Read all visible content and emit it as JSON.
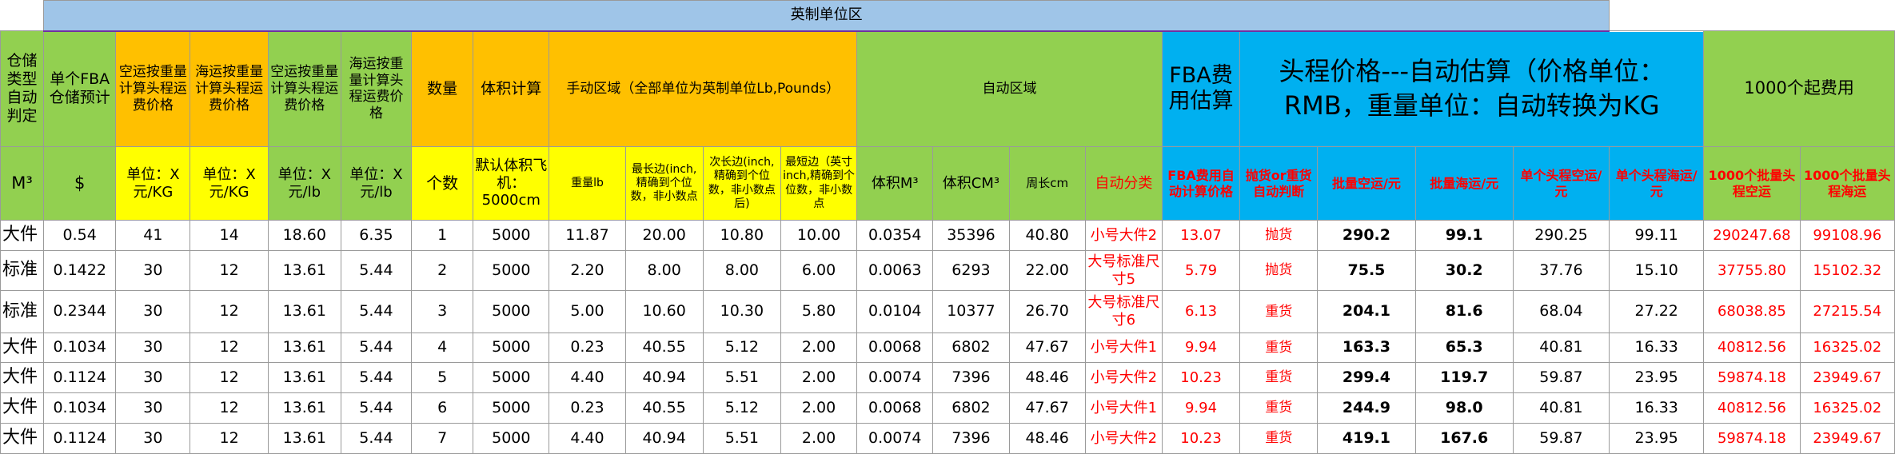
{
  "banner": "英制单位区",
  "header1": [
    "仓储类型自动判定",
    "单个FBA仓储预计",
    "空运按重量计算头程运费价格",
    "海运按重量计算头程运费价格",
    "空运按重量计算头程运费价格",
    "海运按重量计算头程运费价格",
    "数量",
    "体积计算",
    "手动区域（全部单位为英制单位Lb,Pounds）",
    "自动区域",
    "FBA费用估算",
    "头程价格---自动估算（价格单位：RMB，重量单位：自动转换为KG",
    "1000个起费用"
  ],
  "header2": [
    "M³",
    "$",
    "单位：X元/KG",
    "单位：X元/KG",
    "单位：X元/lb",
    "单位：X元/lb",
    "个数",
    "默认体积飞机：5000cm",
    "重量lb",
    "最长边(inch,精确到个位数，非小数点",
    "次长边(inch,精确到个位数，非小数点后)",
    "最短边（英寸inch,精确到个位数，非小数点",
    "体积M³",
    "体积CM³",
    "周长cm",
    "自动分类",
    "FBA费用自动计算价格",
    "抛货or重货自动判断",
    "批量空运/元",
    "批量海运/元",
    "单个头程空运/元",
    "单个头程海运/元",
    "1000个批量头程空运",
    "1000个批量头程海运"
  ],
  "rows": [
    [
      "大件",
      "0.54",
      "41",
      "14",
      "18.60",
      "6.35",
      "1",
      "5000",
      "11.87",
      "20.00",
      "10.80",
      "10.00",
      "0.0354",
      "35396",
      "40.80",
      "小号大件2",
      "13.07",
      "抛货",
      "290.2",
      "99.1",
      "290.25",
      "99.11",
      "290247.68",
      "99108.96"
    ],
    [
      "标准",
      "0.1422",
      "30",
      "12",
      "13.61",
      "5.44",
      "2",
      "5000",
      "2.20",
      "8.00",
      "8.00",
      "6.00",
      "0.0063",
      "6293",
      "22.00",
      "大号标准尺寸5",
      "5.79",
      "抛货",
      "75.5",
      "30.2",
      "37.76",
      "15.10",
      "37755.80",
      "15102.32"
    ],
    [
      "标准",
      "0.2344",
      "30",
      "12",
      "13.61",
      "5.44",
      "3",
      "5000",
      "5.00",
      "10.60",
      "10.30",
      "5.80",
      "0.0104",
      "10377",
      "26.70",
      "大号标准尺寸6",
      "6.13",
      "重货",
      "204.1",
      "81.6",
      "68.04",
      "27.22",
      "68038.85",
      "27215.54"
    ],
    [
      "大件",
      "0.1034",
      "30",
      "12",
      "13.61",
      "5.44",
      "4",
      "5000",
      "0.23",
      "40.55",
      "5.12",
      "2.00",
      "0.0068",
      "6802",
      "47.67",
      "小号大件1",
      "9.94",
      "重货",
      "163.3",
      "65.3",
      "40.81",
      "16.33",
      "40812.56",
      "16325.02"
    ],
    [
      "大件",
      "0.1124",
      "30",
      "12",
      "13.61",
      "5.44",
      "5",
      "5000",
      "4.40",
      "40.94",
      "5.51",
      "2.00",
      "0.0074",
      "7396",
      "48.46",
      "小号大件2",
      "10.23",
      "重货",
      "299.4",
      "119.7",
      "59.87",
      "23.95",
      "59874.18",
      "23949.67"
    ],
    [
      "大件",
      "0.1034",
      "30",
      "12",
      "13.61",
      "5.44",
      "6",
      "5000",
      "0.23",
      "40.55",
      "5.12",
      "2.00",
      "0.0068",
      "6802",
      "47.67",
      "小号大件1",
      "9.94",
      "重货",
      "244.9",
      "98.0",
      "40.81",
      "16.33",
      "40812.56",
      "16325.02"
    ],
    [
      "大件",
      "0.1124",
      "30",
      "12",
      "13.61",
      "5.44",
      "7",
      "5000",
      "4.40",
      "40.94",
      "5.51",
      "2.00",
      "0.0074",
      "7396",
      "48.46",
      "小号大件2",
      "10.23",
      "重货",
      "419.1",
      "167.6",
      "59.87",
      "23.95",
      "59874.18",
      "23949.67"
    ]
  ]
}
